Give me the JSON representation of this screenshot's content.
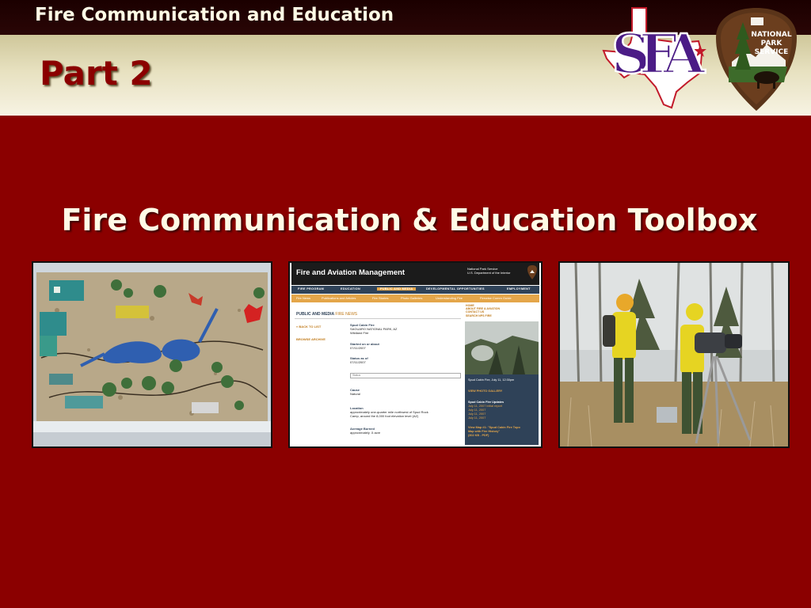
{
  "topbar": {
    "title": "Fire Communication and Education"
  },
  "header": {
    "part_title": "Part 2",
    "logo_sfa_text": "SFA",
    "logo_nps_text": [
      "NATIONAL",
      "PARK",
      "SERVICE"
    ]
  },
  "main": {
    "heading": "Fire Communication & Education Toolbox"
  },
  "colors": {
    "background": "#8b0000",
    "header_text": "#fffbe6",
    "part_title": "#8b0000"
  },
  "photos": [
    {
      "name": "fire-model-diorama"
    },
    {
      "name": "website-screenshot"
    },
    {
      "name": "firefighters-with-camera"
    }
  ],
  "website": {
    "title": "Fire and Aviation Management",
    "agency": [
      "National Park Service",
      "U.S. Department of the Interior"
    ],
    "nav": [
      "FIRE PROGRAM",
      "EDUCATION",
      "PUBLIC AND MEDIA",
      "DEVELOPMENTAL OPPORTUNITIES",
      "EMPLOYMENT"
    ],
    "subnav": [
      "Fire News",
      "Publications and Articles",
      "Fire Stories",
      "Photo Galleries",
      "Understanding Fire",
      "Firewise Comm Guide"
    ],
    "right_links": [
      "HOME",
      "ABOUT FIRE & AVIATION",
      "CONTACT US",
      "SEARCH NPS FIRE"
    ],
    "section": "PUBLIC AND MEDIA",
    "section_sub": "FIRE NEWS",
    "sidebar": [
      "« BACK TO LIST",
      "BROWSE ARCHIVE"
    ],
    "fire_name": "Spud Cabin Fire",
    "park": "SAGUARO NATIONAL PARK, AZ",
    "fire_type": "Wildland Fire",
    "started_label": "Started on or about",
    "started_date": "07/11/2007",
    "status_label": "Status as of",
    "status_date": "07/11/2007",
    "status_field": "Status",
    "cause_label": "Cause",
    "cause_value": "Natural",
    "location_label": "Location",
    "location_value": [
      "approximately one-quarter mile northwest of Spud Rock",
      "Camp, around the 8,000 foot elevation level (AZ)"
    ],
    "acreage_label": "Acreage Burned",
    "acreage_value": "approximately .5 acre",
    "photo_caption": "Spud Cabin Fire, July 11, 12:30pm",
    "gallery_link": "VIEW PHOTO GALLERY",
    "updates_title": "Spud Cabin Fire Updates",
    "updates": [
      "July 11, 2007 initial report",
      "July 11, 2007",
      "July 11, 2007",
      "July 11, 2007"
    ],
    "map_link": [
      "View Map #1: \"Spud Cabin Fire Topo",
      "Map with Fire History\"",
      "(302 KB - PDF)"
    ]
  }
}
